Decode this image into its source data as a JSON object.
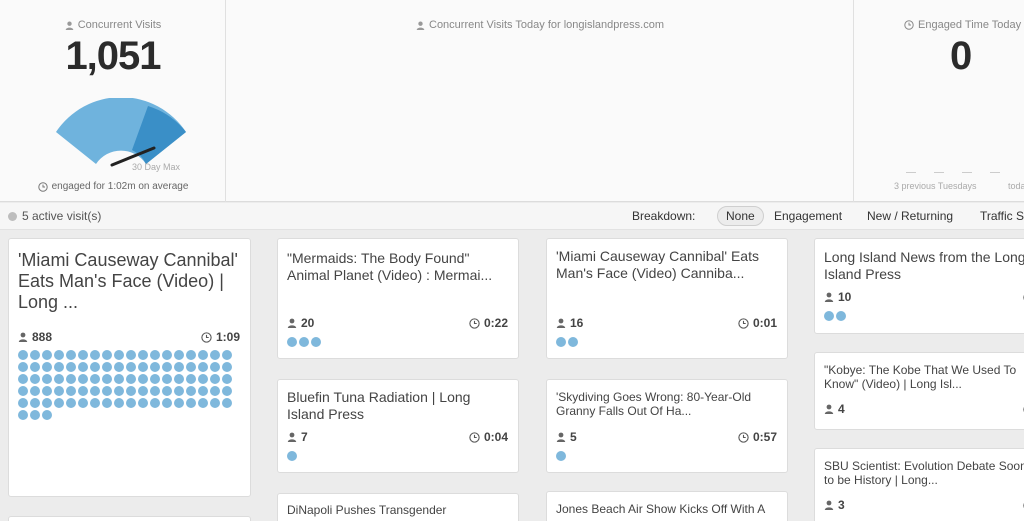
{
  "header": {
    "concurrent": {
      "title": "Concurrent Visits",
      "value": "1,051",
      "gauge_label": "30 Day Max",
      "engaged": "engaged for 1:02m on average"
    },
    "today": {
      "title": "Concurrent Visits Today for longislandpress.com"
    },
    "engaged_time": {
      "title": "Engaged Time Today",
      "value": "0",
      "prev_label": "3 previous Tuesdays",
      "today_label": "toda"
    }
  },
  "subbar": {
    "active": "5 active visit(s)",
    "breakdown_label": "Breakdown:",
    "options": [
      "None",
      "Engagement",
      "New / Returning",
      "Traffic S"
    ]
  },
  "colors": {
    "accent": "#7fb8dc",
    "gauge": "#6fb3dd"
  },
  "cards": [
    {
      "title": "'Miami Causeway Cannibal' Eats Man's Face (Video) | Long ...",
      "visitors": "888",
      "time": "1:09",
      "dots": 93
    },
    {
      "title": "\"Mermaids: The Body Found\" Animal Planet (Video) : Mermai...",
      "visitors": "20",
      "time": "0:22",
      "dots": 3
    },
    {
      "title": "Bluefin Tuna Radiation | Long Island Press",
      "visitors": "7",
      "time": "0:04",
      "dots": 1
    },
    {
      "title": "DiNapoli Pushes Transgender",
      "visitors": "",
      "time": "",
      "dots": 0
    },
    {
      "title": "'Miami Causeway Cannibal' Eats Man's Face (Video) Canniba...",
      "visitors": "16",
      "time": "0:01",
      "dots": 2
    },
    {
      "title": "'Skydiving Goes Wrong: 80-Year-Old Granny Falls Out Of Ha...",
      "visitors": "5",
      "time": "0:57",
      "dots": 1
    },
    {
      "title": "Jones Beach Air Show Kicks Off With A",
      "visitors": "",
      "time": "",
      "dots": 0
    },
    {
      "title": "Long Island News from the Long Island Press",
      "visitors": "10",
      "time": "",
      "dots": 2
    },
    {
      "title": "\"Kobye: The Kobe That We Used To Know\" (Video) | Long Isl...",
      "visitors": "4",
      "time": "",
      "dots": 0
    },
    {
      "title": "SBU Scientist: Evolution Debate Soon to be History | Long...",
      "visitors": "3",
      "time": "",
      "dots": 0
    }
  ]
}
